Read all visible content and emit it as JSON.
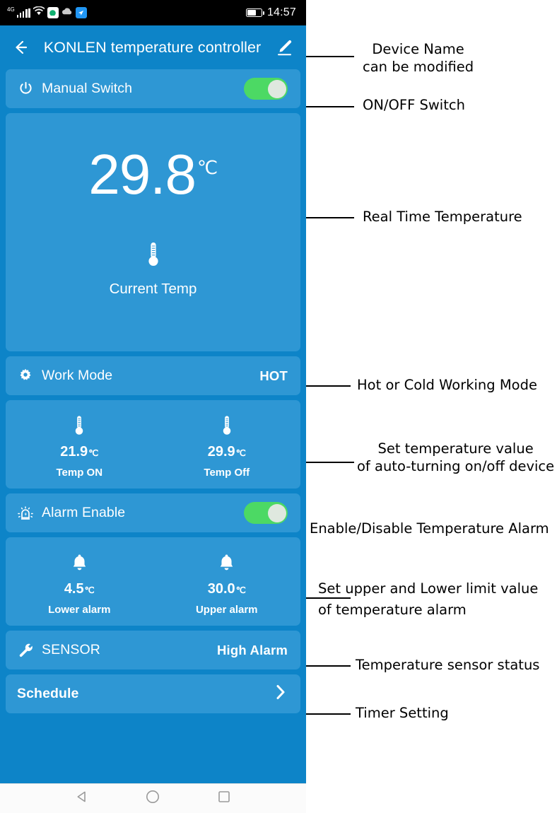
{
  "status_bar": {
    "network_label": "4G",
    "time": "14:57",
    "icons": [
      "signal-bars",
      "wifi",
      "app-green",
      "cloud",
      "app-blue",
      "battery"
    ]
  },
  "header": {
    "back_icon": "back-arrow-icon",
    "title": "KONLEN temperature controller",
    "edit_icon": "pencil-edit-icon"
  },
  "rows": {
    "manual_switch": {
      "icon": "power-icon",
      "label": "Manual Switch",
      "toggle_state": "on"
    },
    "work_mode": {
      "icon": "gear-icon",
      "label": "Work Mode",
      "value": "HOT"
    },
    "alarm_enable": {
      "icon": "alarm-beacon-icon",
      "label": "Alarm Enable",
      "toggle_state": "on"
    },
    "sensor": {
      "icon": "wrench-icon",
      "label": "SENSOR",
      "value": "High Alarm"
    },
    "schedule": {
      "label": "Schedule",
      "chevron": "chevron-right-icon"
    }
  },
  "current_temp": {
    "value": "29.8",
    "unit": "℃",
    "icon": "thermometer-icon",
    "caption": "Current Temp"
  },
  "temp_setpoints": [
    {
      "icon": "thermometer-icon",
      "value": "21.9",
      "unit": "℃",
      "caption": "Temp ON"
    },
    {
      "icon": "thermometer-icon",
      "value": "29.9",
      "unit": "℃",
      "caption": "Temp Off"
    }
  ],
  "alarm_limits": [
    {
      "icon": "bell-icon",
      "value": "4.5",
      "unit": "℃",
      "caption": "Lower alarm"
    },
    {
      "icon": "bell-icon",
      "value": "30.0",
      "unit": "℃",
      "caption": "Upper alarm"
    }
  ],
  "nav_bar": {
    "back": "triangle-back-icon",
    "home": "circle-home-icon",
    "recents": "square-recents-icon"
  },
  "annotations": [
    {
      "text": "Device Name\ncan be modified"
    },
    {
      "text": "ON/OFF Switch"
    },
    {
      "text": "Real Time Temperature"
    },
    {
      "text": "Hot or Cold  Working Mode"
    },
    {
      "text": "Set temperature value\nof auto-turning on/off device"
    },
    {
      "text": "Enable/Disable Temperature Alarm"
    },
    {
      "text": "Set upper and Lower limit value\nof temperature alarm"
    },
    {
      "text": "Temperature sensor status"
    },
    {
      "text": "Timer Setting"
    }
  ],
  "colors": {
    "page_background": "#0d84c8",
    "card_background": "#2e97d4",
    "toggle_on": "#4cd964",
    "toggle_knob": "#dfe8df",
    "status_bar": "#000000",
    "text_white": "#ffffff",
    "annotation_text": "#000000"
  }
}
